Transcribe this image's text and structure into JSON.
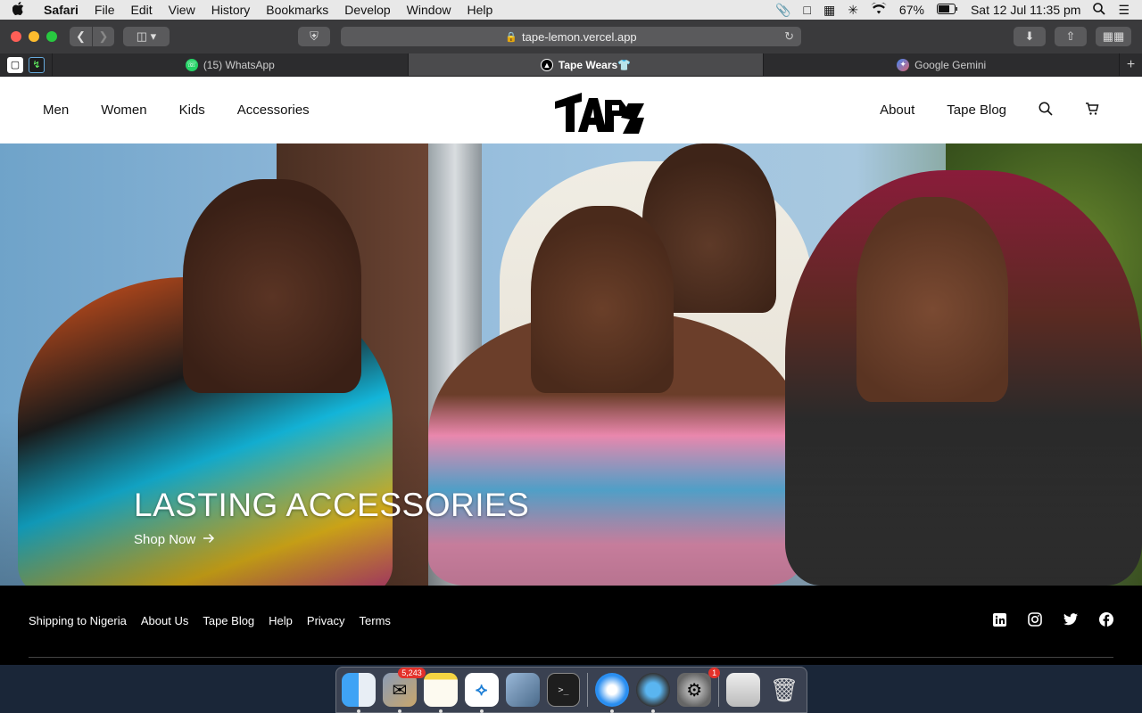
{
  "menubar": {
    "apple": "",
    "items": [
      "Safari",
      "File",
      "Edit",
      "View",
      "History",
      "Bookmarks",
      "Develop",
      "Window",
      "Help"
    ],
    "battery": "67%",
    "datetime": "Sat 12 Jul  11:35 pm"
  },
  "browser": {
    "url": "tape-lemon.vercel.app",
    "tabs": [
      {
        "title": "(15) WhatsApp",
        "icon": "whatsapp-icon"
      },
      {
        "title": "Tape Wears👕",
        "icon": "tape-icon",
        "active": true
      },
      {
        "title": "Google Gemini",
        "icon": "gemini-icon"
      }
    ]
  },
  "site": {
    "nav_left": [
      "Men",
      "Women",
      "Kids",
      "Accessories"
    ],
    "nav_right": [
      "About",
      "Tape Blog"
    ],
    "hero_title": "LASTING ACCESSORIES",
    "hero_cta": "Shop Now",
    "footer_links": [
      "Shipping to Nigeria",
      "About Us",
      "Tape Blog",
      "Help",
      "Privacy",
      "Terms"
    ],
    "social": [
      "linkedin-icon",
      "instagram-icon",
      "twitter-icon",
      "facebook-icon"
    ]
  },
  "dock": {
    "mail_badge": "5,243",
    "settings_badge": "1"
  }
}
